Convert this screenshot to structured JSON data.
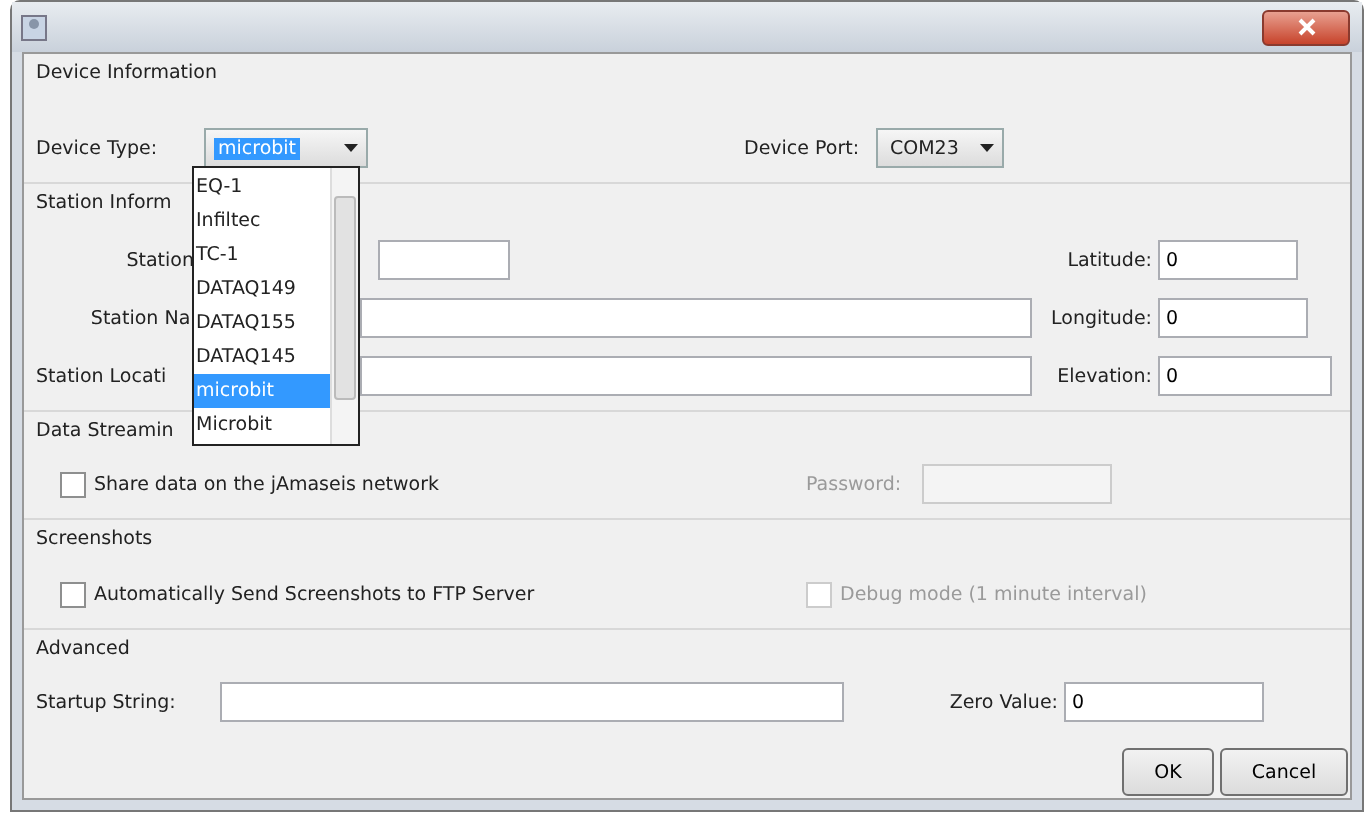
{
  "device_information": {
    "title": "Device Information",
    "device_type": {
      "label": "Device Type:",
      "value": "microbit",
      "options": [
        {
          "label": "EQ-1",
          "selected": false
        },
        {
          "label": "Infiltec",
          "selected": false
        },
        {
          "label": "TC-1",
          "selected": false
        },
        {
          "label": "DATAQ149",
          "selected": false
        },
        {
          "label": "DATAQ155",
          "selected": false
        },
        {
          "label": "DATAQ145",
          "selected": false
        },
        {
          "label": "microbit",
          "selected": true
        },
        {
          "label": "Microbit",
          "selected": false
        }
      ]
    },
    "device_port": {
      "label": "Device Port:",
      "value": "COM23"
    }
  },
  "station_information": {
    "title": "Station Inform",
    "fields": [
      {
        "label": "Station",
        "side_label": "Latitude:",
        "side_value": "0"
      },
      {
        "label": "Station Na",
        "side_label": "Longitude:",
        "side_value": "0"
      },
      {
        "label": "Station Locati",
        "side_label": "Elevation:",
        "side_value": "0"
      }
    ]
  },
  "data_streaming": {
    "title": "Data Streamin",
    "share": {
      "label": "Share data on the jAmaseis network",
      "checked": false
    },
    "password": {
      "label": "Password:",
      "disabled": true
    }
  },
  "screenshots": {
    "title": "Screenshots",
    "auto_send": {
      "label": "Automatically Send Screenshots to FTP Server",
      "checked": false,
      "disabled": false
    },
    "debug_mode": {
      "label": "Debug mode (1 minute interval)",
      "checked": false,
      "disabled": true
    }
  },
  "advanced": {
    "title": "Advanced",
    "startup_string": {
      "label": "Startup String:"
    },
    "zero_value": {
      "label": "Zero Value:",
      "value": "0"
    }
  },
  "buttons": [
    {
      "label": "OK"
    },
    {
      "label": "Cancel"
    }
  ]
}
